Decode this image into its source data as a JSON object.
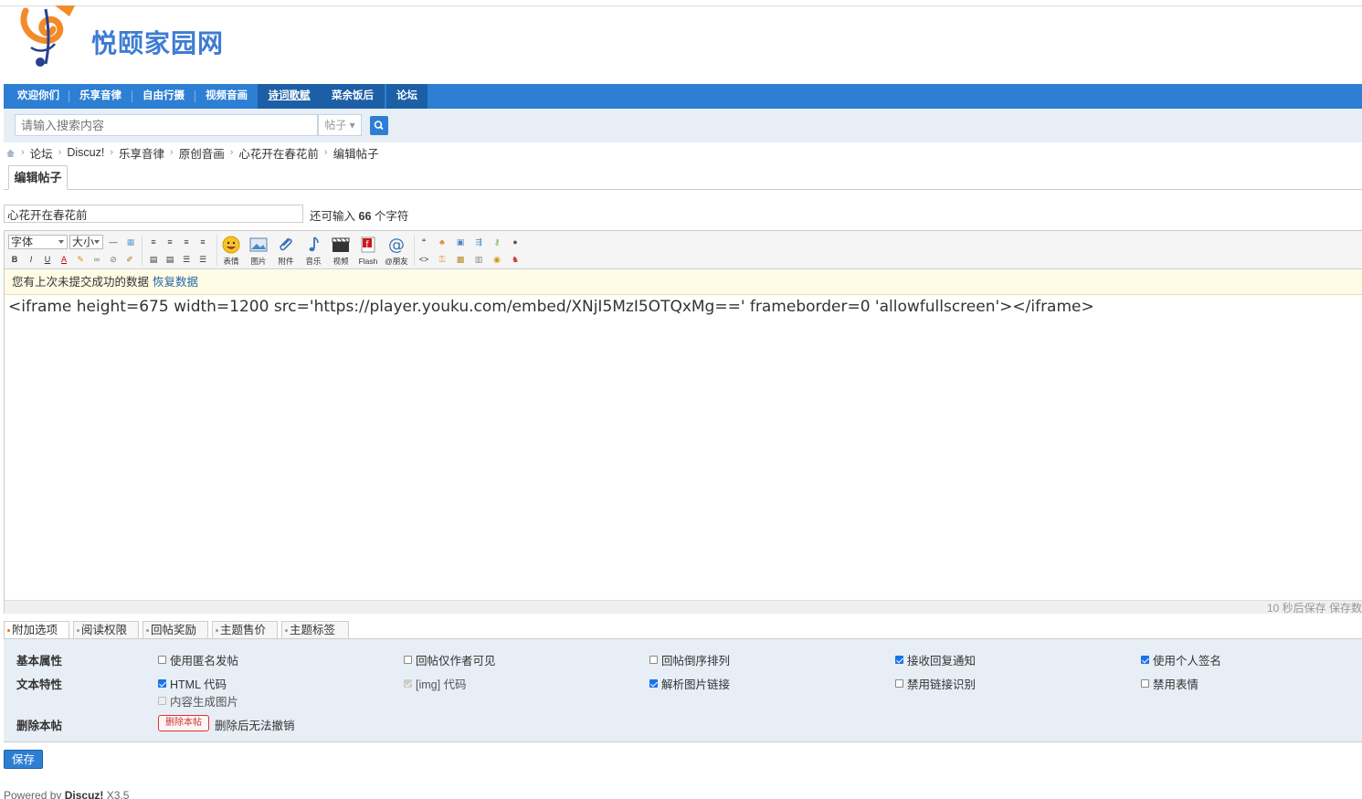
{
  "site": {
    "name": "悦颐家园网"
  },
  "nav": [
    {
      "label": "欢迎你们"
    },
    {
      "label": "乐享音律"
    },
    {
      "label": "自由行摄"
    },
    {
      "label": "视频音画"
    },
    {
      "label": "诗词歌赋"
    },
    {
      "label": "菜余饭后"
    },
    {
      "label": "论坛"
    }
  ],
  "search": {
    "placeholder": "请输入搜索内容",
    "type": "帖子"
  },
  "breadcrumb": [
    "论坛",
    "Discuz!",
    "乐享音律",
    "原创音画",
    "心花开在春花前",
    "编辑帖子"
  ],
  "tab": "编辑帖子",
  "post": {
    "title": "心花开在春花前",
    "remaining_prefix": "还可输入",
    "remaining_count": "66",
    "remaining_suffix": "个字符",
    "content": "<iframe height=675 width=1200 src='https://player.youku.com/embed/XNjI5MzI5OTQxMg==' frameborder=0 'allowfullscreen'></iframe>"
  },
  "editor": {
    "font_select": "字体",
    "size_select": "大小",
    "tools": {
      "emoji": "表情",
      "image": "图片",
      "attach": "附件",
      "music": "音乐",
      "video": "视频",
      "flash": "Flash",
      "friend": "@朋友"
    },
    "notice": "您有上次未提交成功的数据",
    "restore": "恢复数据",
    "autosave": "10 秒后保存 保存数"
  },
  "option_tabs": [
    "附加选项",
    "阅读权限",
    "回帖奖励",
    "主题售价",
    "主题标签"
  ],
  "options": {
    "basic_label": "基本属性",
    "text_label": "文本特性",
    "delete_label": "删除本帖",
    "basic": [
      {
        "label": "使用匿名发帖",
        "checked": false
      },
      {
        "label": "回帖仅作者可见",
        "checked": false
      },
      {
        "label": "回帖倒序排列",
        "checked": false
      },
      {
        "label": "接收回复通知",
        "checked": true
      },
      {
        "label": "使用个人签名",
        "checked": true
      }
    ],
    "text": [
      {
        "label": "HTML 代码",
        "checked": true
      },
      {
        "label": "[img] 代码",
        "checked": true
      },
      {
        "label": "解析图片链接",
        "checked": true
      },
      {
        "label": "禁用链接识别",
        "checked": false
      },
      {
        "label": "禁用表情",
        "checked": false
      },
      {
        "label": "内容生成图片",
        "checked": false
      }
    ],
    "delete_button": "删除本帖",
    "delete_note": "删除后无法撤销"
  },
  "save_button": "保存",
  "footer": {
    "prefix": "Powered by",
    "brand": "Discuz!",
    "version": "X3.5"
  }
}
